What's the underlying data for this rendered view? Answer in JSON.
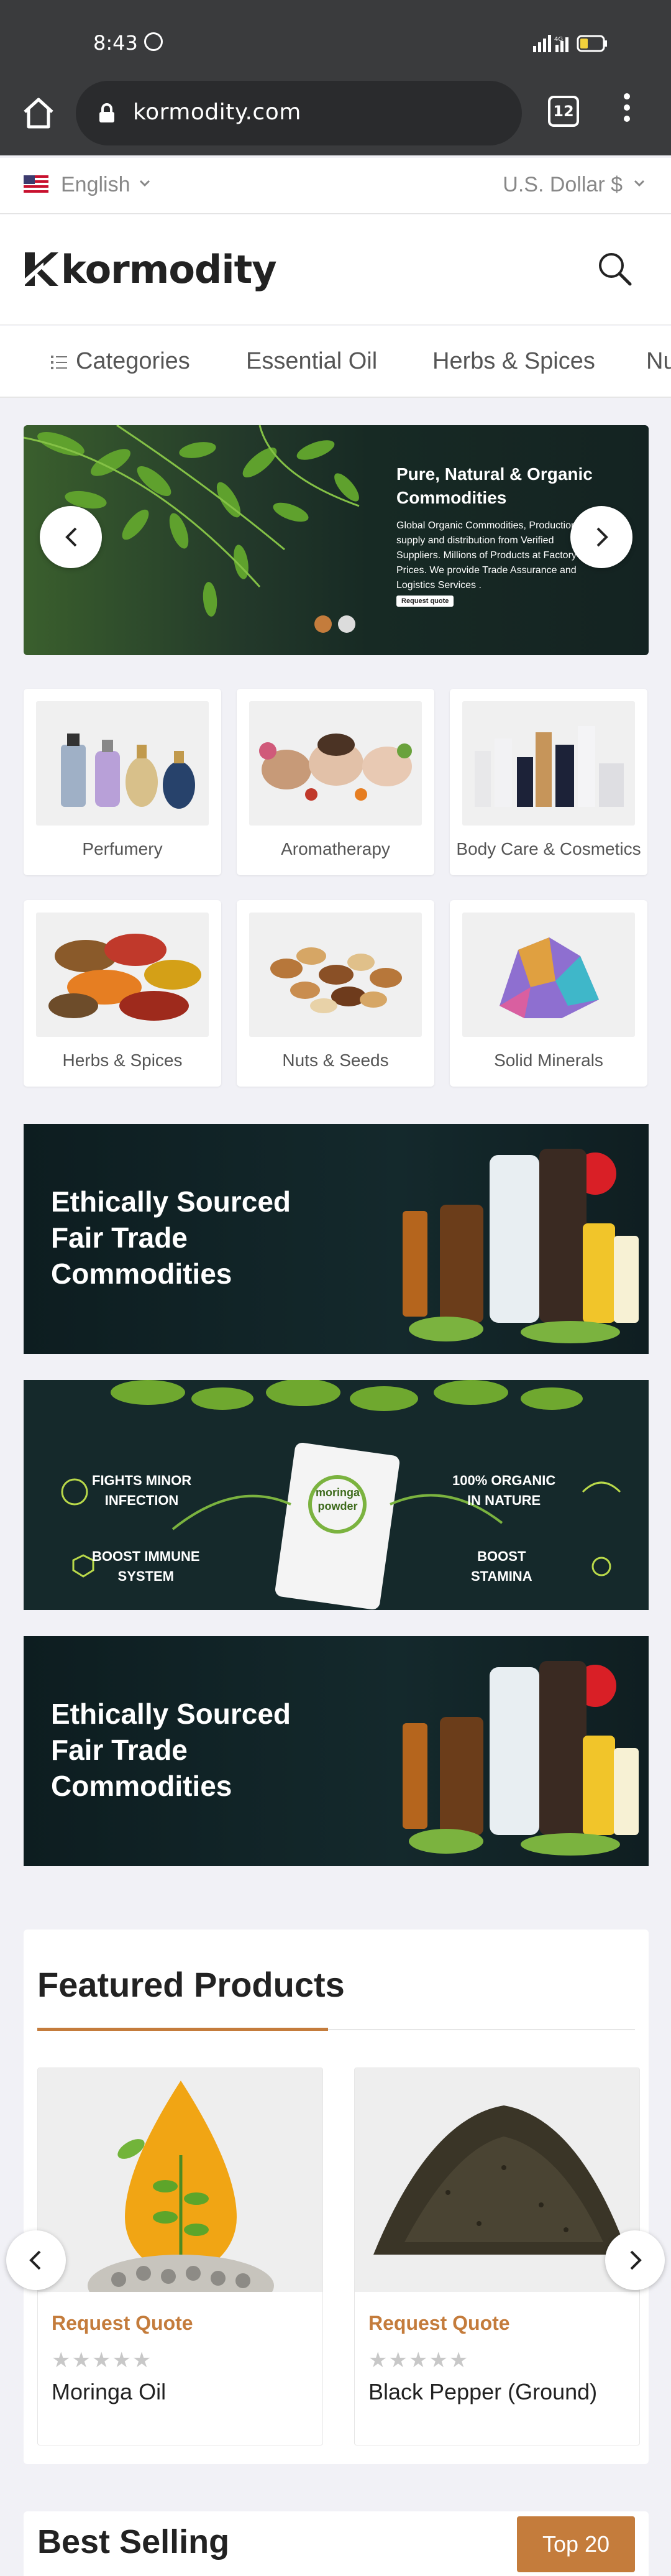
{
  "status_bar": {
    "time": "8:43"
  },
  "browser": {
    "url": "kormodity.com",
    "tab_count": "12"
  },
  "top_bar": {
    "language": "English",
    "currency": "U.S. Dollar $"
  },
  "header": {
    "logo_text": "kormodity"
  },
  "nav": {
    "items": [
      "Categories",
      "Essential Oil",
      "Herbs & Spices",
      "Nu"
    ]
  },
  "hero": {
    "title": "Pure, Natural & Organic Commodities",
    "body": "Global  Organic Commodities, Production, supply and distribution  from Verified Suppliers.  Millions of Products at Factory Prices.  We provide  Trade Assurance and Logistics Services .",
    "button": "Request quote",
    "active_slide": 1,
    "slide_count": 2
  },
  "categories": [
    {
      "label": "Perfumery"
    },
    {
      "label": "Aromatherapy"
    },
    {
      "label": "Body Care & Cosmetics"
    },
    {
      "label": "Herbs & Spices"
    },
    {
      "label": "Nuts & Seeds"
    },
    {
      "label": "Solid Minerals"
    }
  ],
  "promos": {
    "banner1": "Ethically Sourced\nFair Trade\nCommodities",
    "banner2_features": [
      "FIGHTS MINOR\nINFECTION",
      "100% ORGANIC\nIN NATURE",
      "BOOST IMMUNE\nSYSTEM",
      "BOOST\nSTAMINA"
    ],
    "banner2_product": "moringa\npowder",
    "banner3": "Ethically Sourced\nFair Trade\nCommodities"
  },
  "featured": {
    "title": "Featured Products",
    "products": [
      {
        "cta": "Request Quote",
        "rating": 0,
        "name": "Moringa Oil"
      },
      {
        "cta": "Request Quote",
        "rating": 0,
        "name": "Black Pepper (Ground)"
      }
    ]
  },
  "best_selling": {
    "title": "Best Selling",
    "button": "Top 20"
  },
  "colors": {
    "accent": "#c47c3c",
    "dark_bar": "#3a3b3d",
    "banner_dark": "#14292c"
  }
}
